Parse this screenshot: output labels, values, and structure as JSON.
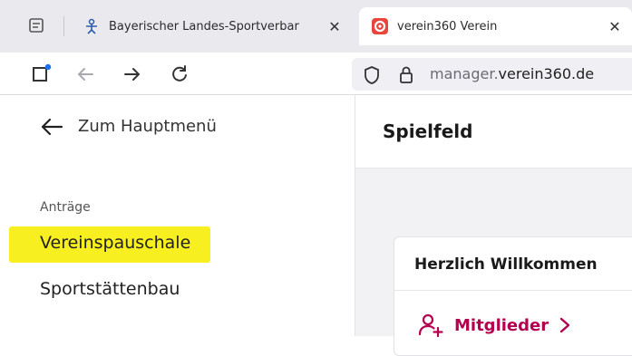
{
  "browser": {
    "tabs": [
      {
        "title": "Bayerischer Landes-Sportverbar",
        "close": "✕",
        "active": false
      },
      {
        "title": "verein360 Verein",
        "close": "✕",
        "active": true
      }
    ],
    "url": {
      "prefix": "manager.",
      "domain": "verein360.de"
    },
    "icons": [
      "tab-list-icon",
      "blsv-favicon-icon",
      "verein360-favicon-icon",
      "new-tab-icon",
      "back-arrow-icon",
      "forward-arrow-icon",
      "reload-icon",
      "shield-icon",
      "lock-icon"
    ],
    "colors": {
      "tabstrip": "#e9e9ee",
      "verein360_brand": "#e8453c"
    }
  },
  "sidebar": {
    "back_label": "Zum Hauptmenü",
    "section_label": "Anträge",
    "items": [
      {
        "label": "Vereinspauschale",
        "highlighted": true
      },
      {
        "label": "Sportstättenbau",
        "highlighted": false
      }
    ],
    "highlight_color": "#f7ef1f"
  },
  "main": {
    "title": "Spielfeld",
    "card": {
      "title": "Herzlich Willkommen",
      "link_label": "Mitglieder",
      "link_color": "#b4004e"
    }
  }
}
